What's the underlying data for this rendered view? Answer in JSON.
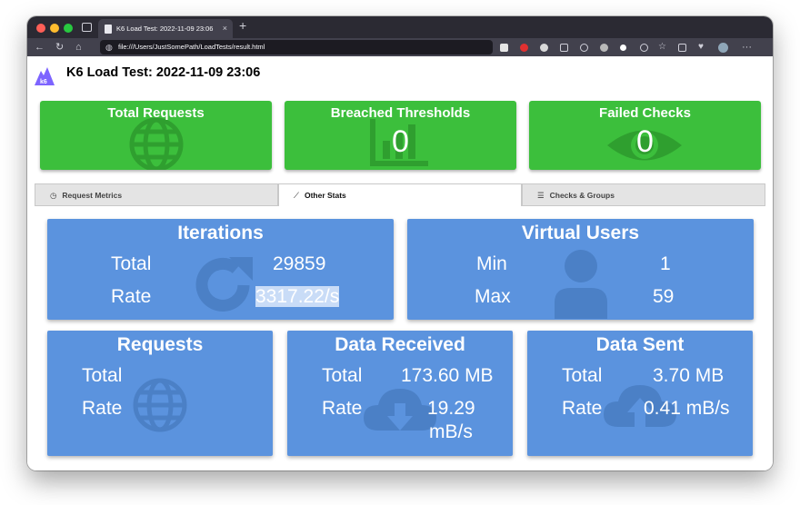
{
  "browser": {
    "tab_title": "K6 Load Test: 2022-11-09 23:06",
    "tab_close": "×",
    "new_tab": "+",
    "url": "file:///Users/JustSomePath/LoadTests/result.html"
  },
  "page": {
    "title": "K6 Load Test: 2022-11-09 23:06",
    "logo_text": "k6"
  },
  "summary_cards": [
    {
      "title": "Total Requests",
      "value": "",
      "icon": "globe-icon"
    },
    {
      "title": "Breached Thresholds",
      "value": "0",
      "icon": "chart-icon"
    },
    {
      "title": "Failed Checks",
      "value": "0",
      "icon": "eye-icon"
    }
  ],
  "tabs": [
    {
      "label": "Request Metrics",
      "icon": "clock-icon",
      "glyph": "◷",
      "active": false
    },
    {
      "label": "Other Stats",
      "icon": "line-chart-icon",
      "glyph": "⟋",
      "active": true
    },
    {
      "label": "Checks & Groups",
      "icon": "list-icon",
      "glyph": "☰",
      "active": false
    }
  ],
  "iterations": {
    "title": "Iterations",
    "total_label": "Total",
    "total_value": "29859",
    "rate_label": "Rate",
    "rate_value": "3317.22/s"
  },
  "virtual_users": {
    "title": "Virtual Users",
    "min_label": "Min",
    "min_value": "1",
    "max_label": "Max",
    "max_value": "59"
  },
  "requests": {
    "title": "Requests",
    "total_label": "Total",
    "total_value": "",
    "rate_label": "Rate",
    "rate_value": ""
  },
  "data_received": {
    "title": "Data Received",
    "total_label": "Total",
    "total_value": "173.60 MB",
    "rate_label": "Rate",
    "rate_value_1": "19.29",
    "rate_value_2": "mB/s"
  },
  "data_sent": {
    "title": "Data Sent",
    "total_label": "Total",
    "total_value": "3.70 MB",
    "rate_label": "Rate",
    "rate_value": "0.41 mB/s"
  },
  "colors": {
    "green_card": "#3cbf3c",
    "blue_card": "#5b93de",
    "k6_purple": "#7d64ff"
  }
}
